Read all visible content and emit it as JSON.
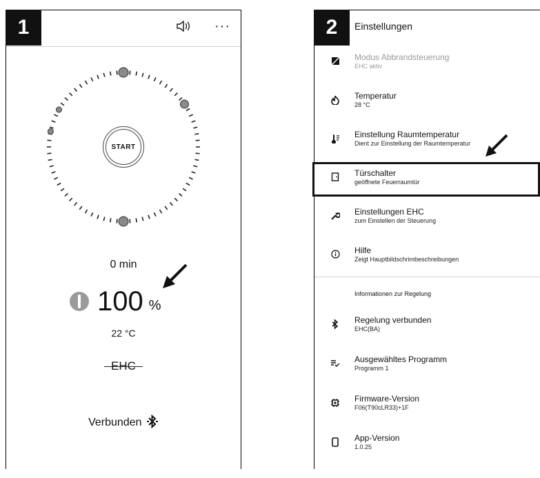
{
  "left": {
    "step_number": "1",
    "start_label": "START",
    "timer": "0 min",
    "power_value": "100",
    "power_unit": "%",
    "temperature": "22 °C",
    "mode": "EHC",
    "status": "Verbunden",
    "icons": [
      "sound-icon",
      "more-icon",
      "bluetooth-icon",
      "flame-icon"
    ]
  },
  "right": {
    "step_number": "2",
    "title": "Einstellungen",
    "items": [
      {
        "title": "Modus Abbrandsteuerung",
        "sub": "EHC aktiv",
        "icon": "mode-icon",
        "disabled": true
      },
      {
        "title": "Temperatur",
        "sub": "28 °C",
        "icon": "flame-icon"
      },
      {
        "title": "Einstellung Raumtemperatur",
        "sub": "Dient zur Einstellung der Raumtemperatur",
        "icon": "thermometer-icon"
      },
      {
        "title": "Türschalter",
        "sub": "geöffnete Feuerraumtür",
        "icon": "door-icon"
      },
      {
        "title": "Einstellungen EHC",
        "sub": "zum Einstellen der Steuerung",
        "icon": "wrench-icon"
      },
      {
        "title": "Hilfe",
        "sub": "Zeigt Hauptbildschrimbeschreibungen",
        "icon": "info-icon"
      }
    ],
    "info_heading": "Informationen zur Regelung",
    "info_items": [
      {
        "title": "Regelung verbunden",
        "sub": "EHC(BA)",
        "icon": "bluetooth-icon"
      },
      {
        "title": "Ausgewähltes Programm",
        "sub": "Programm 1",
        "icon": "list-check-icon"
      },
      {
        "title": "Firmware-Version",
        "sub": "F06(T90cLR33)+1F",
        "icon": "chip-icon"
      },
      {
        "title": "App-Version",
        "sub": "1.0.25",
        "icon": "phone-icon"
      }
    ]
  }
}
